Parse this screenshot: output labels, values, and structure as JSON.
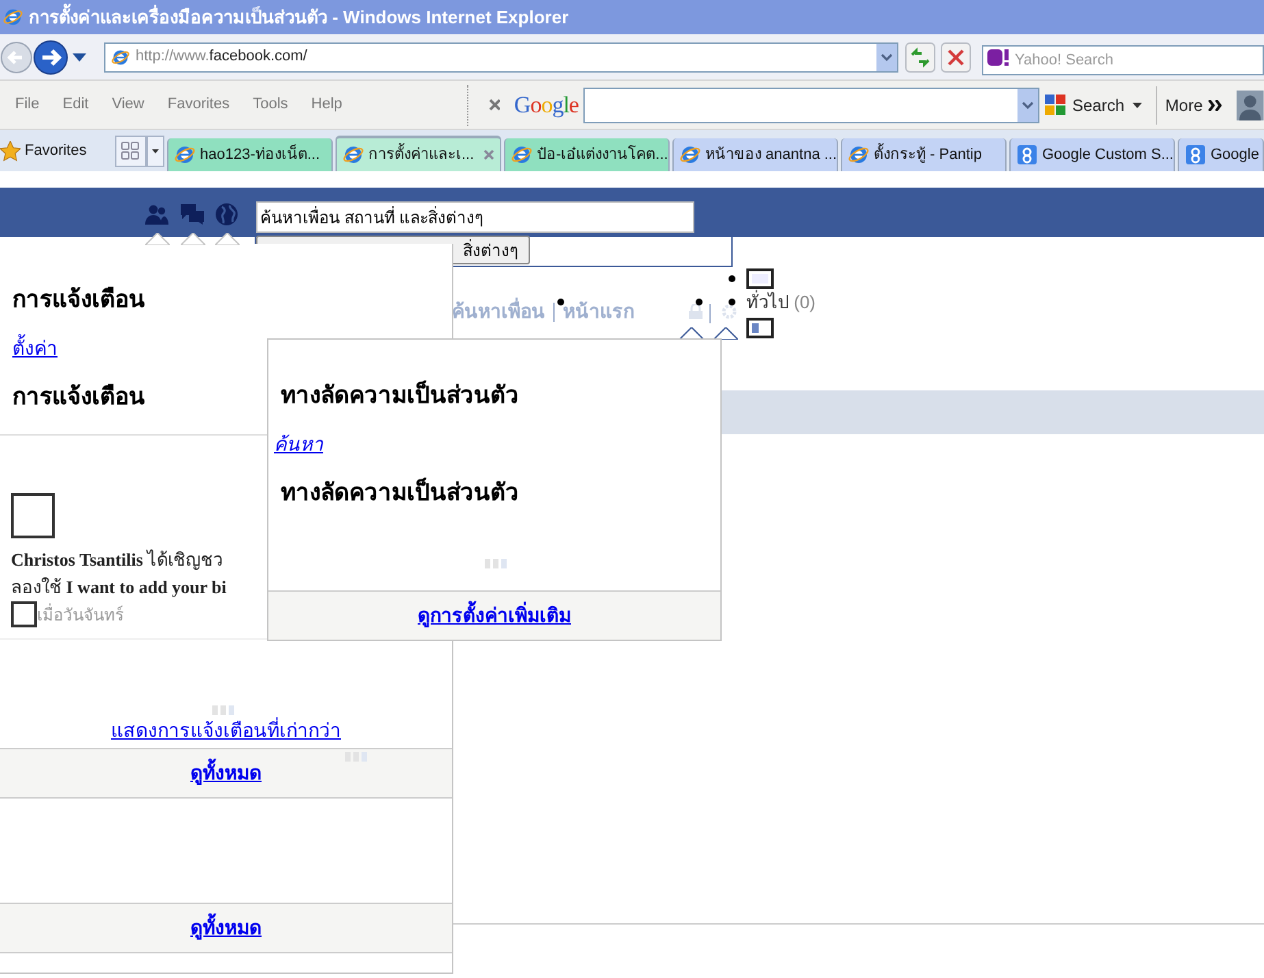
{
  "window": {
    "title": "การตั้งค่าและเครื่องมือความเป็นส่วนตัว - Windows Internet Explorer"
  },
  "address_bar": {
    "url_prefix": "http://www.",
    "url_host": "facebook.com/"
  },
  "search_box": {
    "placeholder": "Yahoo! Search"
  },
  "menu": [
    "File",
    "Edit",
    "View",
    "Favorites",
    "Tools",
    "Help"
  ],
  "google_toolbar": {
    "logo": "Google",
    "search_button": "Search",
    "more_button": "More"
  },
  "favorites": "Favorites",
  "tabs": [
    {
      "label": "hao123-ท่องเน็ต...",
      "kind": "ie",
      "color": "#8fe0bf",
      "selected": false
    },
    {
      "label": "การตั้งค่าและเ...",
      "kind": "ie",
      "color": "#b8ecd6",
      "selected": true
    },
    {
      "label": "ป๋อ-เอ๋แต่งงานโคต...",
      "kind": "ie",
      "color": "#8fe0bf",
      "selected": false
    },
    {
      "label": "หน้าของ anantna ...",
      "kind": "ie",
      "color": "#c3d3f5",
      "selected": false
    },
    {
      "label": "ตั้งกระทู้ - Pantip",
      "kind": "ie",
      "color": "#c3d3f5",
      "selected": false
    },
    {
      "label": "Google Custom S...",
      "kind": "google",
      "color": "#c3d3f5",
      "selected": false
    },
    {
      "label": "Google",
      "kind": "google",
      "color": "#c3d3f5",
      "selected": false
    }
  ],
  "facebook": {
    "search": {
      "value": "ค้นหาเพื่อน สถานที่ และสิ่งต่างๆ"
    },
    "search_button": "สิ่งต่างๆ",
    "nav": [
      "ค้นหาเพื่อน",
      "หน้าแรก"
    ],
    "general": {
      "label": "ทั่วไป",
      "count": "(0)"
    }
  },
  "notifications_popup": {
    "title": "การแจ้งเตือน",
    "settings_link": "ตั้งค่า",
    "subtitle": "การแจ้งเตือน",
    "items": [
      {
        "text": "**Christos Tsantilis** ได้เชิญชว",
        "text_2": "ลองใช้ **I want to add your bi**",
        "time": "เมื่อวันจันทร์"
      }
    ],
    "older_link": "แสดงการแจ้งเตือนที่เก่ากว่า",
    "footers": [
      "ดูทั้งหมด",
      "ดูทั้งหมด"
    ]
  },
  "privacy_popup": {
    "title": "ทางลัดความเป็นส่วนตัว",
    "search_link": "ค้นหา",
    "subtitle": "ทางลัดความเป็นส่วนตัว",
    "footer": "ดูการตั้งค่าเพิ่มเติม"
  }
}
